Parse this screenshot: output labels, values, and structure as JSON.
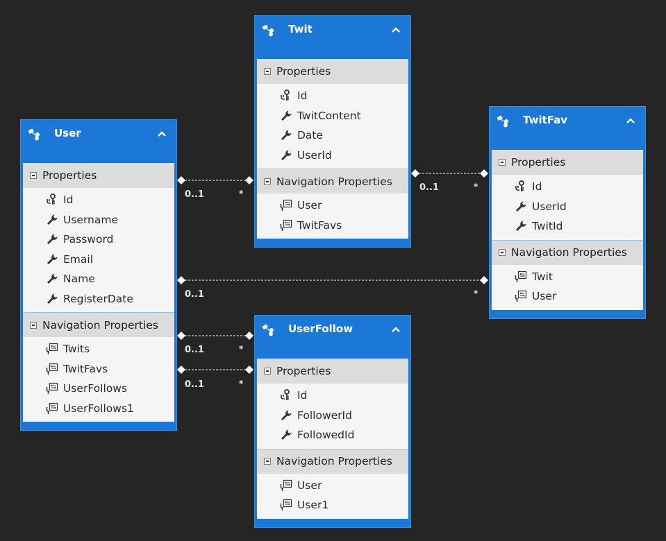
{
  "diagram": {
    "theme_colors": {
      "background": "#252526",
      "entity_header": "#1c78d6",
      "section_header": "#dcdcdc",
      "item_background": "#f5f5f5"
    },
    "section_labels": {
      "properties": "Properties",
      "navigation": "Navigation Properties"
    },
    "entities": {
      "user": {
        "title": "User",
        "icon": "entity-icon",
        "collapse_icon": "chevron-up-icon",
        "properties": [
          {
            "name": "Id",
            "icon": "key-icon"
          },
          {
            "name": "Username",
            "icon": "wrench-icon"
          },
          {
            "name": "Password",
            "icon": "wrench-icon"
          },
          {
            "name": "Email",
            "icon": "wrench-icon"
          },
          {
            "name": "Name",
            "icon": "wrench-icon"
          },
          {
            "name": "RegisterDate",
            "icon": "wrench-icon"
          }
        ],
        "navigation": [
          {
            "name": "Twits",
            "icon": "navigation-property-icon"
          },
          {
            "name": "TwitFavs",
            "icon": "navigation-property-icon"
          },
          {
            "name": "UserFollows",
            "icon": "navigation-property-icon"
          },
          {
            "name": "UserFollows1",
            "icon": "navigation-property-icon"
          }
        ]
      },
      "twit": {
        "title": "Twit",
        "icon": "entity-icon",
        "collapse_icon": "chevron-up-icon",
        "properties": [
          {
            "name": "Id",
            "icon": "key-icon"
          },
          {
            "name": "TwitContent",
            "icon": "wrench-icon"
          },
          {
            "name": "Date",
            "icon": "wrench-icon"
          },
          {
            "name": "UserId",
            "icon": "wrench-icon"
          }
        ],
        "navigation": [
          {
            "name": "User",
            "icon": "navigation-property-icon"
          },
          {
            "name": "TwitFavs",
            "icon": "navigation-property-icon"
          }
        ]
      },
      "twitfav": {
        "title": "TwitFav",
        "icon": "entity-icon",
        "collapse_icon": "chevron-up-icon",
        "properties": [
          {
            "name": "Id",
            "icon": "key-icon"
          },
          {
            "name": "UserId",
            "icon": "wrench-icon"
          },
          {
            "name": "TwitId",
            "icon": "wrench-icon"
          }
        ],
        "navigation": [
          {
            "name": "Twit",
            "icon": "navigation-property-icon"
          },
          {
            "name": "User",
            "icon": "navigation-property-icon"
          }
        ]
      },
      "userfollow": {
        "title": "UserFollow",
        "icon": "entity-icon",
        "collapse_icon": "chevron-up-icon",
        "properties": [
          {
            "name": "Id",
            "icon": "key-icon"
          },
          {
            "name": "FollowerId",
            "icon": "wrench-icon"
          },
          {
            "name": "FollowedId",
            "icon": "wrench-icon"
          }
        ],
        "navigation": [
          {
            "name": "User",
            "icon": "navigation-property-icon"
          },
          {
            "name": "User1",
            "icon": "navigation-property-icon"
          }
        ]
      }
    },
    "associations": [
      {
        "from": "User",
        "to": "Twit",
        "from_multiplicity": "0..1",
        "to_multiplicity": "*"
      },
      {
        "from": "Twit",
        "to": "TwitFav",
        "from_multiplicity": "0..1",
        "to_multiplicity": "*"
      },
      {
        "from": "User",
        "to": "TwitFav",
        "from_multiplicity": "0..1",
        "to_multiplicity": "*"
      },
      {
        "from": "User",
        "to": "UserFollow",
        "from_multiplicity": "0..1",
        "to_multiplicity": "*"
      },
      {
        "from": "User",
        "to": "UserFollow",
        "from_multiplicity": "0..1",
        "to_multiplicity": "*"
      }
    ]
  }
}
